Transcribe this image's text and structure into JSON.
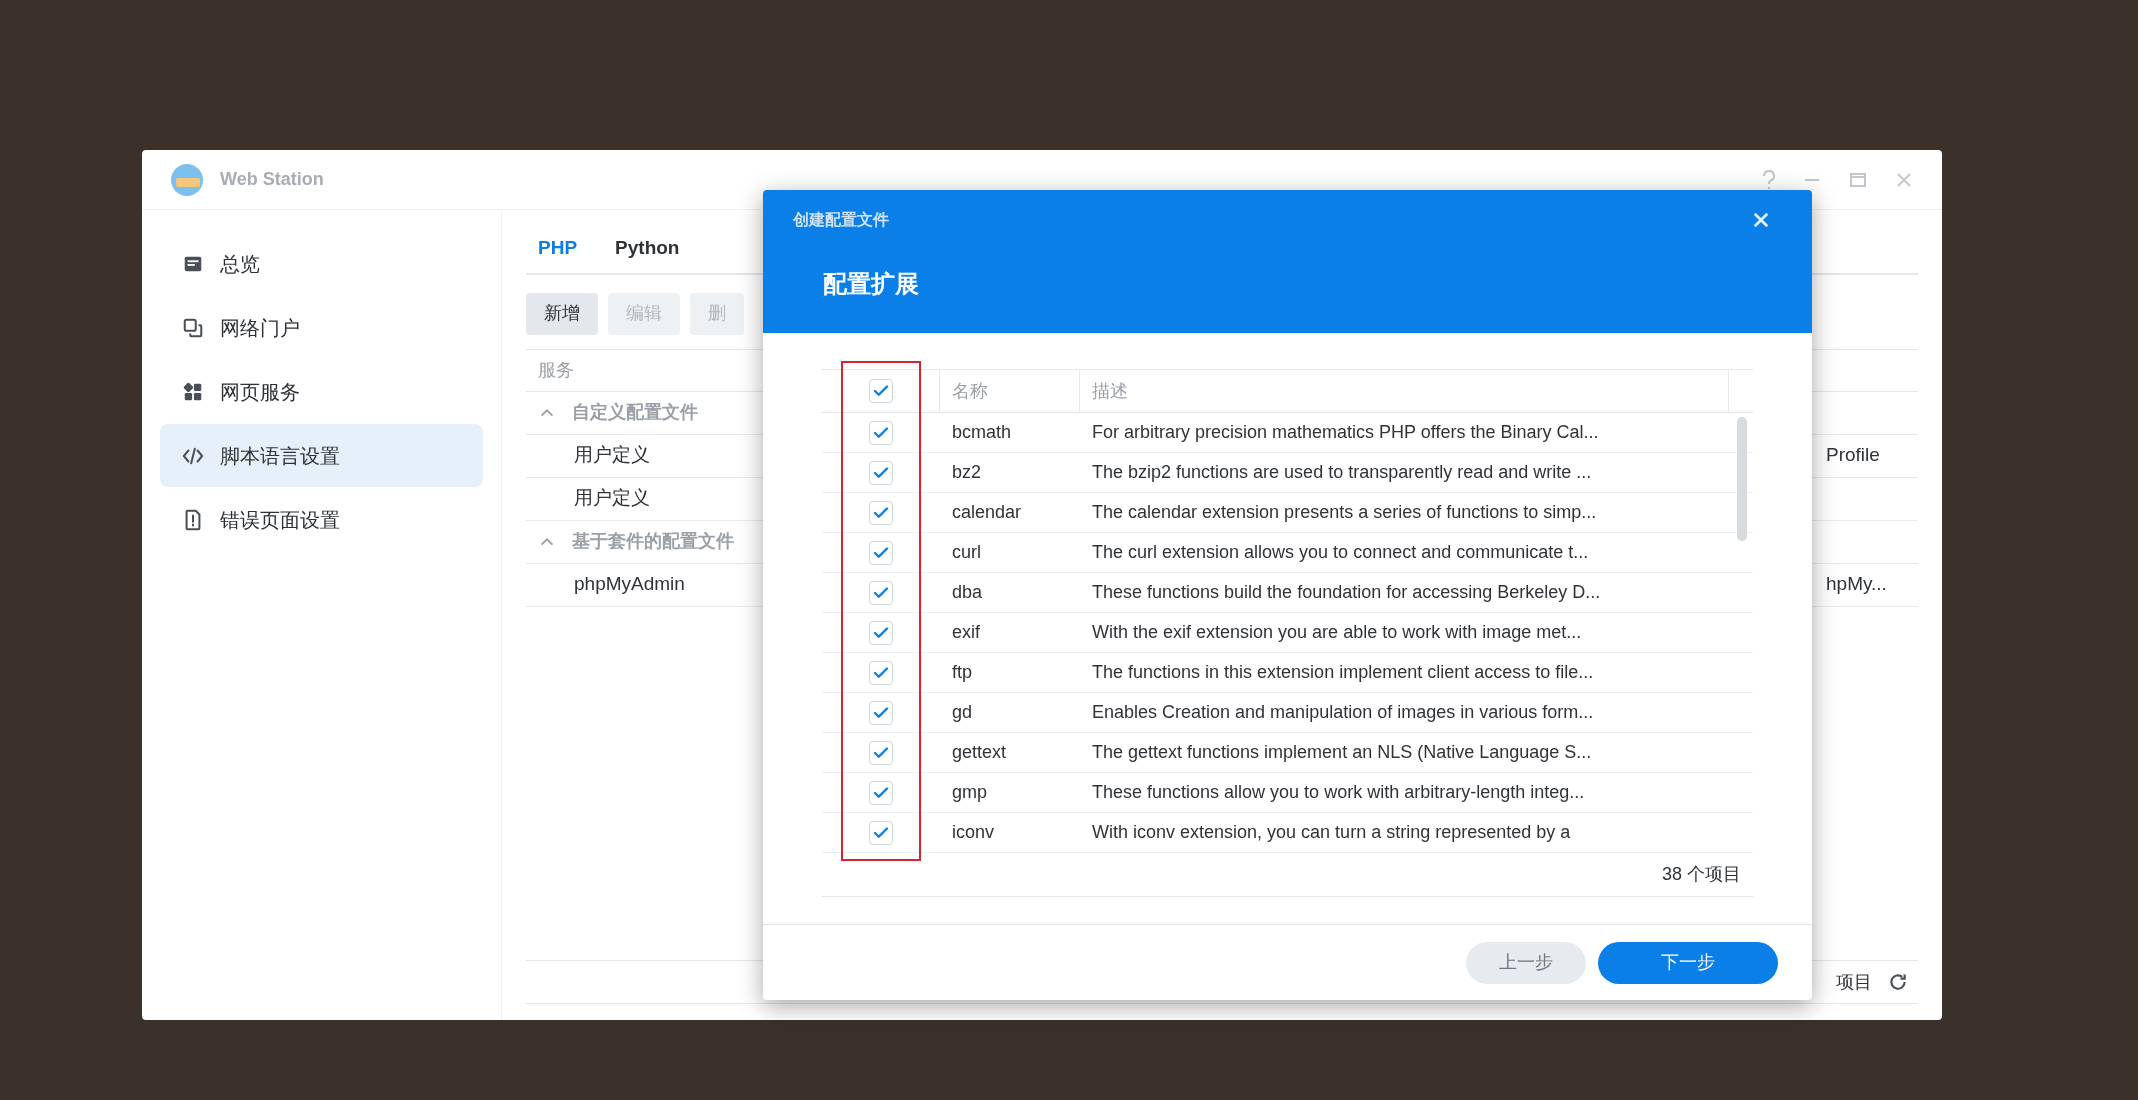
{
  "window": {
    "title": "Web Station"
  },
  "sidebar": {
    "items": [
      {
        "label": "总览",
        "selected": false
      },
      {
        "label": "网络门户",
        "selected": false
      },
      {
        "label": "网页服务",
        "selected": false
      },
      {
        "label": "脚本语言设置",
        "selected": true
      },
      {
        "label": "错误页面设置",
        "selected": false
      }
    ]
  },
  "tabs": [
    {
      "label": "PHP",
      "selected": true
    },
    {
      "label": "Python",
      "selected": false
    }
  ],
  "toolbar": [
    {
      "label": "新增",
      "disabled": false
    },
    {
      "label": "编辑",
      "disabled": true
    },
    {
      "label": "删",
      "disabled": true
    }
  ],
  "table": {
    "columns": [
      "服务"
    ],
    "rows": [
      {
        "kind": "group",
        "label": "自定义配置文件",
        "expanded": true
      },
      {
        "kind": "item",
        "label": "用户定义",
        "column_2": "Profile"
      },
      {
        "kind": "item",
        "label": "用户定义"
      },
      {
        "kind": "group",
        "label": "基于套件的配置文件",
        "expanded": true
      },
      {
        "kind": "item",
        "label": "phpMyAdmin",
        "column_2": "hpMy..."
      }
    ]
  },
  "status_bar": {
    "count": "项目"
  },
  "dialog": {
    "title": "创建配置文件",
    "heading": "配置扩展",
    "table": {
      "select_all_checked": true,
      "columns": [
        "名称",
        "描述"
      ],
      "rows": [
        {
          "name": "bcmath",
          "description": "For arbitrary precision mathematics PHP offers the Binary Cal...",
          "checked": true
        },
        {
          "name": "bz2",
          "description": "The bzip2 functions are used to transparently read and write ...",
          "checked": true
        },
        {
          "name": "calendar",
          "description": "The calendar extension presents a series of functions to simp...",
          "checked": true
        },
        {
          "name": "curl",
          "description": "The curl extension allows you to connect and communicate t...",
          "checked": true
        },
        {
          "name": "dba",
          "description": "These functions build the foundation for accessing Berkeley D...",
          "checked": true
        },
        {
          "name": "exif",
          "description": "With the exif extension you are able to work with image met...",
          "checked": true
        },
        {
          "name": "ftp",
          "description": "The functions in this extension implement client access to file...",
          "checked": true
        },
        {
          "name": "gd",
          "description": "Enables Creation and manipulation of images in various form...",
          "checked": true
        },
        {
          "name": "gettext",
          "description": "The gettext functions implement an NLS (Native Language S...",
          "checked": true
        },
        {
          "name": "gmp",
          "description": "These functions allow you to work with arbitrary-length integ...",
          "checked": true
        },
        {
          "name": "iconv",
          "description": "With iconv extension, you can turn a string represented by a",
          "checked": true
        }
      ]
    },
    "count": "38 个项目",
    "buttons": [
      {
        "label": "上一步",
        "kind": "secondary"
      },
      {
        "label": "下一步",
        "kind": "primary"
      }
    ]
  }
}
